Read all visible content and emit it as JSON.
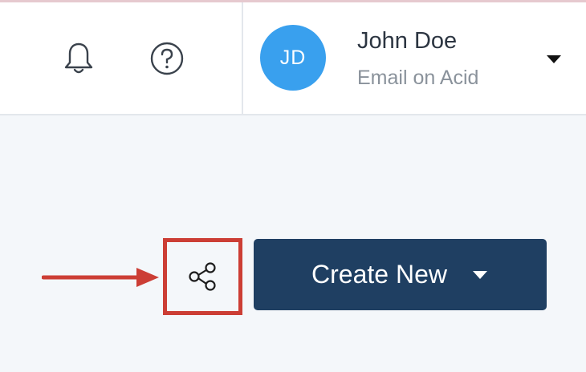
{
  "header": {
    "icons": {
      "notifications": "bell-icon",
      "help": "question-circle-icon"
    },
    "account": {
      "initials": "JD",
      "name": "John Doe",
      "organization": "Email on Acid",
      "avatar_color": "#39a0ee",
      "dropdown_icon": "caret-down-icon"
    }
  },
  "toolbar": {
    "share_icon": "share-icon",
    "create_label": "Create New",
    "create_dropdown_icon": "caret-down-icon",
    "create_color": "#1f3f62"
  },
  "annotation": {
    "highlight_color": "#cc3e35"
  }
}
